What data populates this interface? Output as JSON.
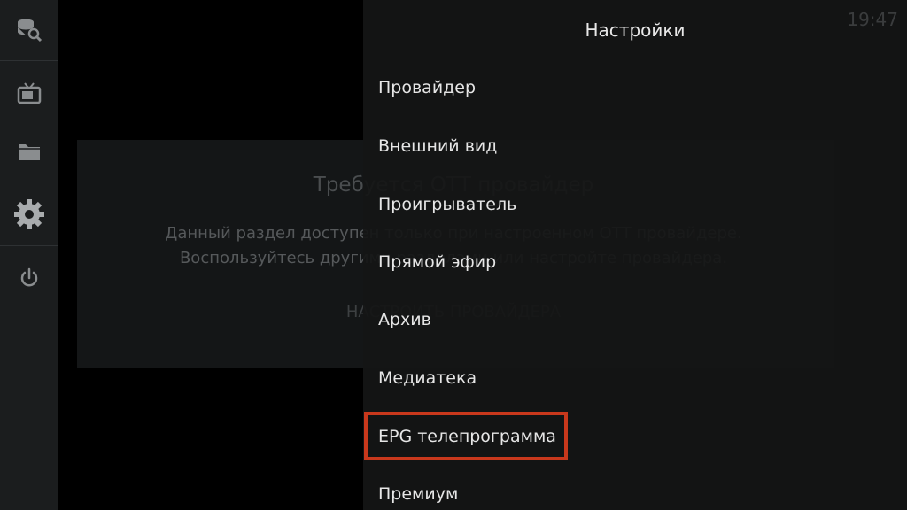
{
  "clock": "19:47",
  "sidebar": {
    "items": [
      {
        "icon": "search-db-icon"
      },
      {
        "icon": "tv-icon"
      },
      {
        "icon": "folder-icon"
      },
      {
        "icon": "gear-icon",
        "selected": true
      },
      {
        "icon": "power-icon"
      }
    ]
  },
  "card": {
    "title": "Требуется ОТТ провайдер",
    "line1": "Данный раздел доступен только при настроенном ОТТ провайдере.",
    "line2": "Воспользуйтесь другими разделами или настройте провайдера.",
    "button": "НАСТРОИТЬ ПРОВАЙДЕРА"
  },
  "settings": {
    "title": "Настройки",
    "items": [
      "Провайдер",
      "Внешний вид",
      "Проигрыватель",
      "Прямой эфир",
      "Архив",
      "Медиатека",
      "EPG телепрограмма",
      "Премиум"
    ],
    "highlighted_item": "EPG телепрограмма",
    "highlight_color": "#c8381c"
  }
}
